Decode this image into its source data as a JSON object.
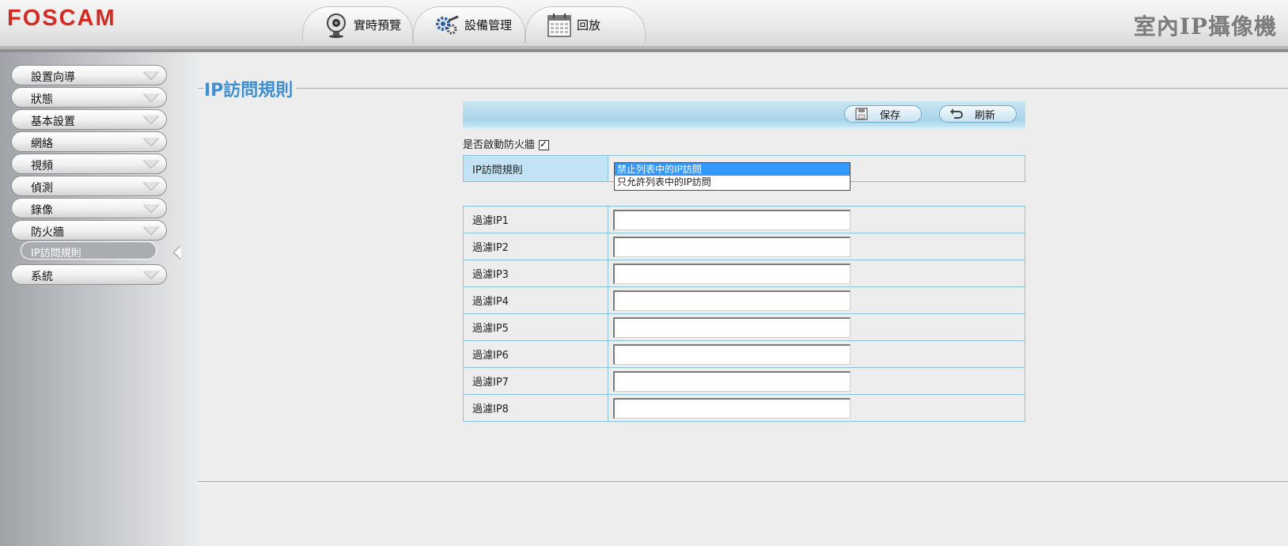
{
  "header": {
    "logo_text": "FOSCAM",
    "product_title": "室內IP攝像機",
    "tabs": [
      {
        "label": "實時預覽",
        "icon": "webcam-icon"
      },
      {
        "label": "設備管理",
        "icon": "gears-icon"
      },
      {
        "label": "回放",
        "icon": "calendar-icon"
      }
    ]
  },
  "sidebar": {
    "items": [
      {
        "label": "設置向導"
      },
      {
        "label": "狀態"
      },
      {
        "label": "基本設置"
      },
      {
        "label": "網絡"
      },
      {
        "label": "視頻"
      },
      {
        "label": "偵測"
      },
      {
        "label": "錄像"
      },
      {
        "label": "防火牆"
      },
      {
        "label": "系統"
      }
    ],
    "active_sub_item": "IP訪問規則"
  },
  "content": {
    "section_title": "IP訪問規則",
    "toolbar": {
      "save_label": "保存",
      "refresh_label": "刷新"
    },
    "enable_firewall_label": "是否啟動防火牆",
    "enable_firewall_checked": true,
    "rule_label": "IP訪問規則",
    "rule_options": [
      {
        "label": "禁止列表中的IP訪問",
        "selected": true
      },
      {
        "label": "只允許列表中的IP訪問",
        "selected": false
      }
    ],
    "filters": [
      {
        "label": "過濾IP1",
        "value": ""
      },
      {
        "label": "過濾IP2",
        "value": ""
      },
      {
        "label": "過濾IP3",
        "value": ""
      },
      {
        "label": "過濾IP4",
        "value": ""
      },
      {
        "label": "過濾IP5",
        "value": ""
      },
      {
        "label": "過濾IP6",
        "value": ""
      },
      {
        "label": "過濾IP7",
        "value": ""
      },
      {
        "label": "過濾IP8",
        "value": ""
      }
    ]
  },
  "colors": {
    "brand": "#d32b22",
    "title_blue": "#3f8fd0",
    "toolbar_blue": "#a9d4e9",
    "table_border": "#87c3dc",
    "selected_option": "#3399ff"
  }
}
